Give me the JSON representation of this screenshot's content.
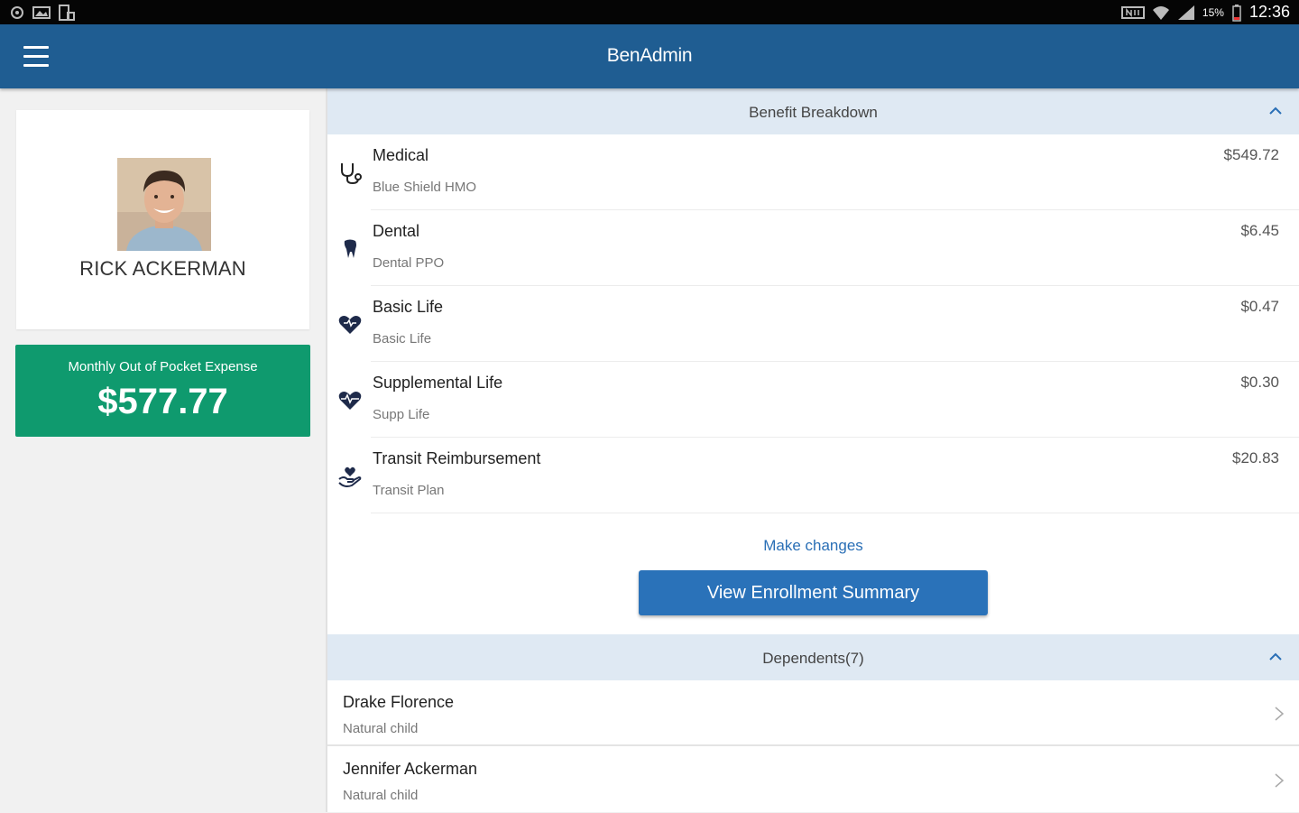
{
  "status_bar": {
    "left_icons": [
      "sync-icon",
      "gallery-icon",
      "phone-storage-icon"
    ],
    "right_icons": [
      "nfc-icon",
      "wifi-icon",
      "signal-icon",
      "battery-icon"
    ],
    "battery_text": "15%",
    "time": "12:36"
  },
  "app_bar": {
    "menu_icon": "hamburger-menu-icon",
    "title": "BenAdmin"
  },
  "profile": {
    "name": "RICK ACKERMAN",
    "avatar": "avatar-photo"
  },
  "expense": {
    "label": "Monthly Out of Pocket Expense",
    "amount": "$577.77",
    "color": "#0f9a6e"
  },
  "benefits": {
    "title": "Benefit Breakdown",
    "collapse_icon": "chevron-up-icon",
    "items": [
      {
        "name": "Medical",
        "plan": "Blue Shield HMO",
        "amount": "$549.72",
        "icon": "stethoscope-icon"
      },
      {
        "name": "Dental",
        "plan": "Dental PPO",
        "amount": "$6.45",
        "icon": "tooth-icon"
      },
      {
        "name": "Basic Life",
        "plan": "Basic Life",
        "amount": "$0.47",
        "icon": "heart-icon"
      },
      {
        "name": "Supplemental Life",
        "plan": "Supp Life",
        "amount": "$0.30",
        "icon": "heartbeat-icon"
      },
      {
        "name": "Transit Reimbursement",
        "plan": "Transit Plan",
        "amount": "$20.83",
        "icon": "hand-heart-icon"
      }
    ],
    "make_changes": "Make changes",
    "view_summary": "View Enrollment Summary"
  },
  "dependents": {
    "title": "Dependents(7)",
    "collapse_icon": "chevron-up-icon",
    "items": [
      {
        "name": "Drake Florence",
        "relation": "Natural child"
      },
      {
        "name": "Jennifer Ackerman",
        "relation": "Natural child"
      }
    ]
  },
  "colors": {
    "app_bar": "#1f5d92",
    "button": "#2a72b9",
    "section_header": "#dfe9f3",
    "link": "#2a6fb6"
  }
}
